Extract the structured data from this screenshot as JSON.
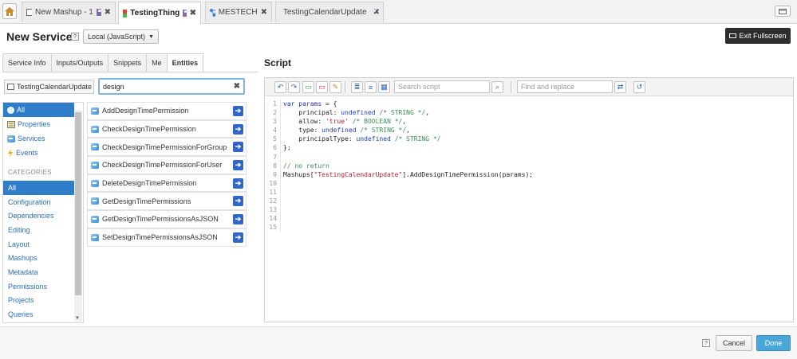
{
  "tabs": [
    {
      "label": "New Mashup - 1"
    },
    {
      "label": "TestingThing"
    },
    {
      "label": "MESTECH"
    },
    {
      "label": "TestingCalendarUpdate"
    }
  ],
  "header": {
    "title": "New Service",
    "help": "?",
    "language": "Local (JavaScript)",
    "exit_fullscreen": "Exit Fullscreen"
  },
  "left_tabs": [
    "Service Info",
    "Inputs/Outputs",
    "Snippets",
    "Me",
    "Entities"
  ],
  "entity_select": "TestingCalendarUpdate",
  "search": {
    "value": "design",
    "clear": "✖"
  },
  "nav": {
    "items": [
      "All",
      "Properties",
      "Services",
      "Events"
    ],
    "categories_title": "CATEGORIES",
    "categories": [
      "All",
      "Configuration",
      "Dependencies",
      "Editing",
      "Layout",
      "Mashups",
      "Metadata",
      "Permissions",
      "Projects",
      "Queries"
    ]
  },
  "services": [
    "AddDesignTimePermission",
    "CheckDesignTimePermission",
    "CheckDesignTimePermissionForGroup",
    "CheckDesignTimePermissionForUser",
    "DeleteDesignTimePermission",
    "GetDesignTimePermissions",
    "GetDesignTimePermissionsAsJSON",
    "SetDesignTimePermissionsAsJSON"
  ],
  "script": {
    "title": "Script",
    "search_placeholder": "Search script",
    "replace_placeholder": "Find and replace",
    "line_numbers": [
      "1",
      "2",
      "3",
      "4",
      "5",
      "6",
      "7",
      "8",
      "9",
      "10",
      "11",
      "12",
      "13",
      "14",
      "15"
    ]
  },
  "footer": {
    "help": "?",
    "cancel": "Cancel",
    "done": "Done"
  },
  "colors": {
    "accent": "#2e7dc9",
    "done": "#4aa6d8",
    "exit_btn": "#2d2d2d"
  }
}
